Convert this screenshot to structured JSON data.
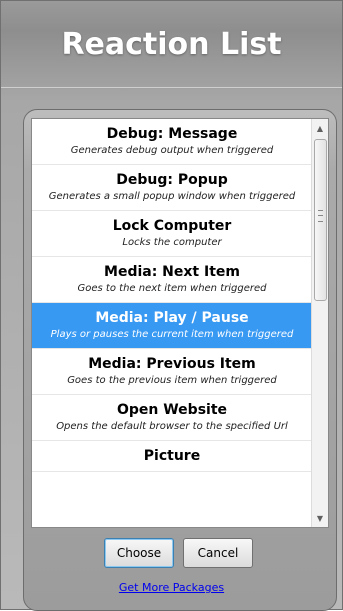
{
  "window": {
    "title": "Reaction List"
  },
  "list": {
    "items": [
      {
        "title": "Debug: Message",
        "desc": "Generates debug output when triggered",
        "selected": false
      },
      {
        "title": "Debug: Popup",
        "desc": "Generates a small popup window when triggered",
        "selected": false
      },
      {
        "title": "Lock Computer",
        "desc": "Locks the computer",
        "selected": false
      },
      {
        "title": "Media: Next Item",
        "desc": "Goes to the next item when triggered",
        "selected": false
      },
      {
        "title": "Media: Play / Pause",
        "desc": "Plays or pauses the current item when triggered",
        "selected": true
      },
      {
        "title": "Media: Previous Item",
        "desc": "Goes to the previous item when triggered",
        "selected": false
      },
      {
        "title": "Open Website",
        "desc": "Opens the default browser to the specified Url",
        "selected": false
      },
      {
        "title": "Picture",
        "desc": "",
        "selected": false
      }
    ]
  },
  "buttons": {
    "choose": "Choose",
    "cancel": "Cancel"
  },
  "links": {
    "more_packages": "Get More Packages"
  },
  "colors": {
    "selection": "#3899f3"
  }
}
